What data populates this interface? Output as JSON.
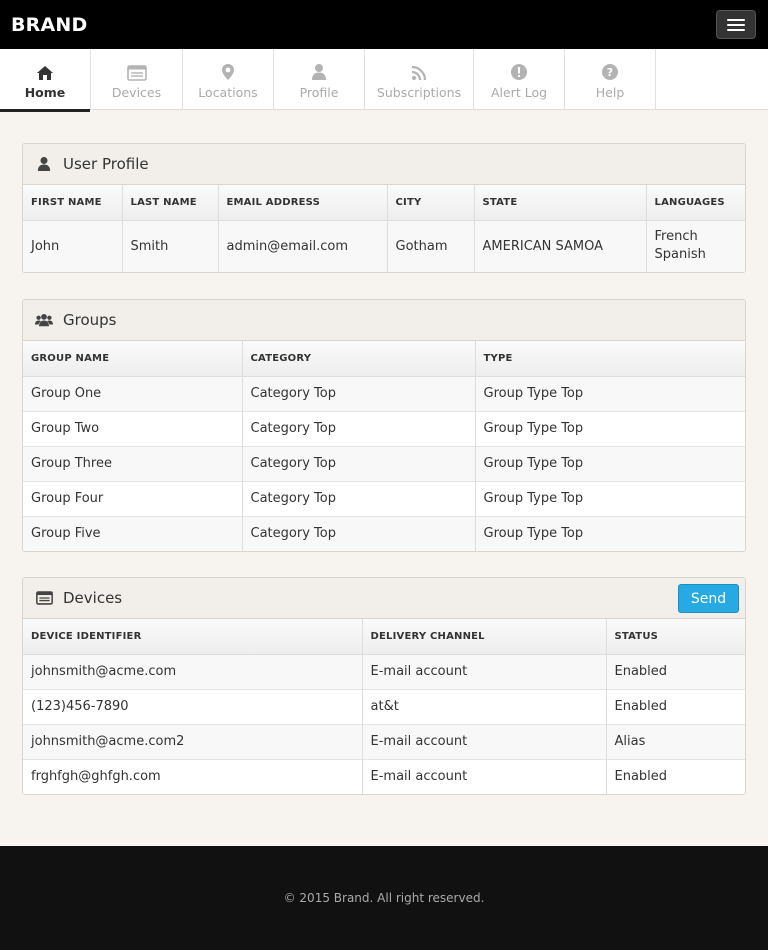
{
  "brand": "BRAND",
  "nav": {
    "tabs": [
      {
        "label": "Home",
        "icon": "home-icon"
      },
      {
        "label": "Devices",
        "icon": "devices-icon"
      },
      {
        "label": "Locations",
        "icon": "map-marker-icon"
      },
      {
        "label": "Profile",
        "icon": "user-icon"
      },
      {
        "label": "Subscriptions",
        "icon": "rss-icon"
      },
      {
        "label": "Alert Log",
        "icon": "alert-icon"
      },
      {
        "label": "Help",
        "icon": "help-icon"
      }
    ]
  },
  "user_profile": {
    "title": "User Profile",
    "headers": [
      "FIRST NAME",
      "LAST NAME",
      "EMAIL ADDRESS",
      "CITY",
      "STATE",
      "LANGUAGES"
    ],
    "row": {
      "first_name": "John",
      "last_name": "Smith",
      "email": "admin@email.com",
      "city": "Gotham",
      "state": "AMERICAN SAMOA",
      "languages": [
        "French",
        "Spanish"
      ]
    }
  },
  "groups": {
    "title": "Groups",
    "headers": [
      "GROUP NAME",
      "CATEGORY",
      "TYPE"
    ],
    "rows": [
      [
        "Group One",
        "Category Top",
        "Group Type Top"
      ],
      [
        "Group Two",
        "Category Top",
        "Group Type Top"
      ],
      [
        "Group Three",
        "Category Top",
        "Group Type Top"
      ],
      [
        "Group Four",
        "Category Top",
        "Group Type Top"
      ],
      [
        "Group Five",
        "Category Top",
        "Group Type Top"
      ]
    ]
  },
  "devices": {
    "title": "Devices",
    "send_label": "Send",
    "headers": [
      "DEVICE IDENTIFIER",
      "DELIVERY CHANNEL",
      "STATUS"
    ],
    "rows": [
      [
        "johnsmith@acme.com",
        "E-mail account",
        "Enabled"
      ],
      [
        "(123)456-7890",
        "at&t",
        "Enabled"
      ],
      [
        "johnsmith@acme.com2",
        "E-mail account",
        "Alias"
      ],
      [
        "frghfgh@ghfgh.com",
        "E-mail account",
        "Enabled"
      ]
    ]
  },
  "footer": "© 2015 Brand. All right reserved.",
  "colors": {
    "accent": "#27a9e3",
    "topbar": "#000000",
    "page_bg": "#f7f4ef",
    "footer_bg": "#111111"
  }
}
